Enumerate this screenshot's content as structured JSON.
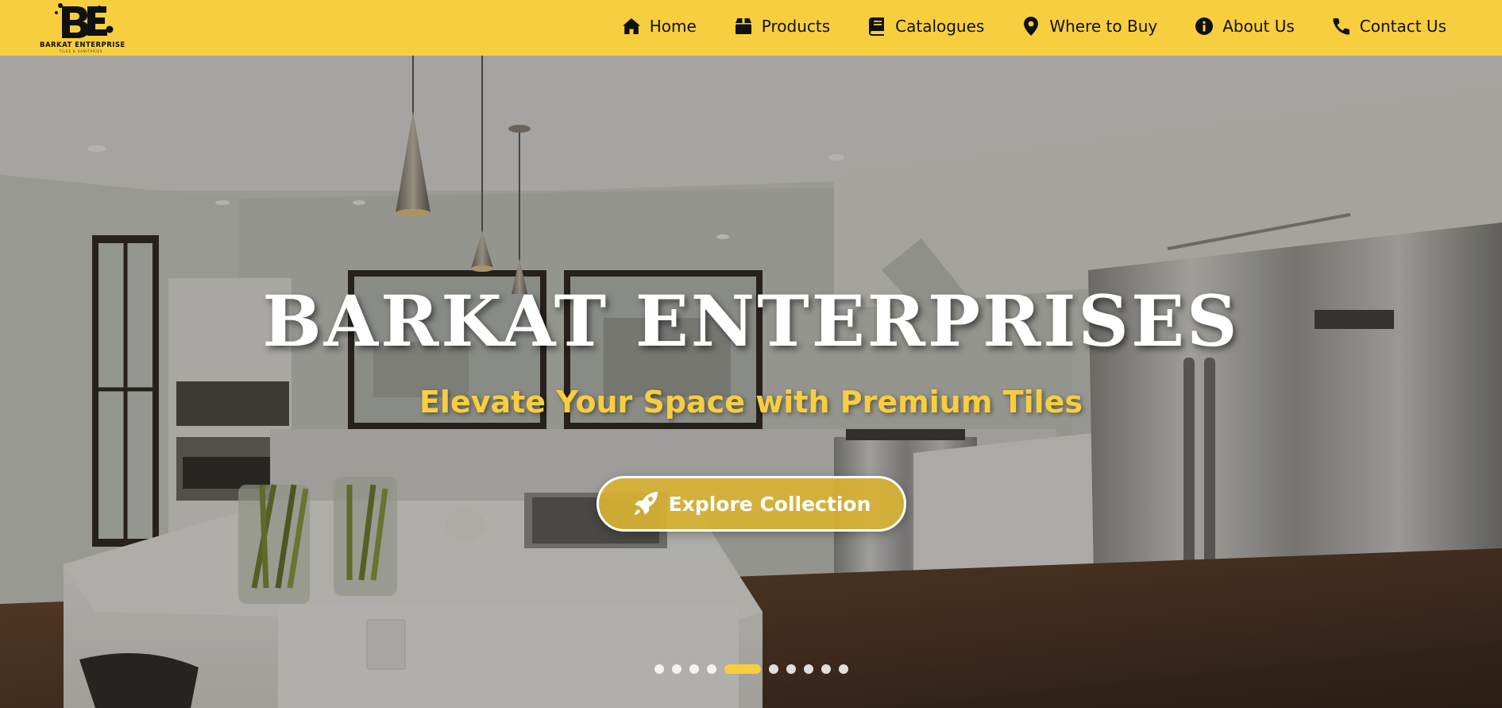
{
  "brand": {
    "logo_mark": "BE",
    "name": "BARKAT ENTERPRISE",
    "tagline": "TILES & SANITARIES",
    "accent_color": "#f7ce3e"
  },
  "nav": {
    "items": [
      {
        "label": "Home",
        "icon": "home-icon"
      },
      {
        "label": "Products",
        "icon": "box-icon"
      },
      {
        "label": "Catalogues",
        "icon": "book-icon"
      },
      {
        "label": "Where to Buy",
        "icon": "map-pin-icon"
      },
      {
        "label": "About Us",
        "icon": "info-icon"
      },
      {
        "label": "Contact Us",
        "icon": "phone-icon"
      }
    ]
  },
  "hero": {
    "title": "BARKAT ENTERPRISES",
    "subtitle": "Elevate Your Space with Premium Tiles",
    "cta_label": "Explore Collection",
    "cta_icon": "rocket-icon",
    "background": "kitchen-interior-photo",
    "slides_total": 11,
    "active_slide": 5
  }
}
